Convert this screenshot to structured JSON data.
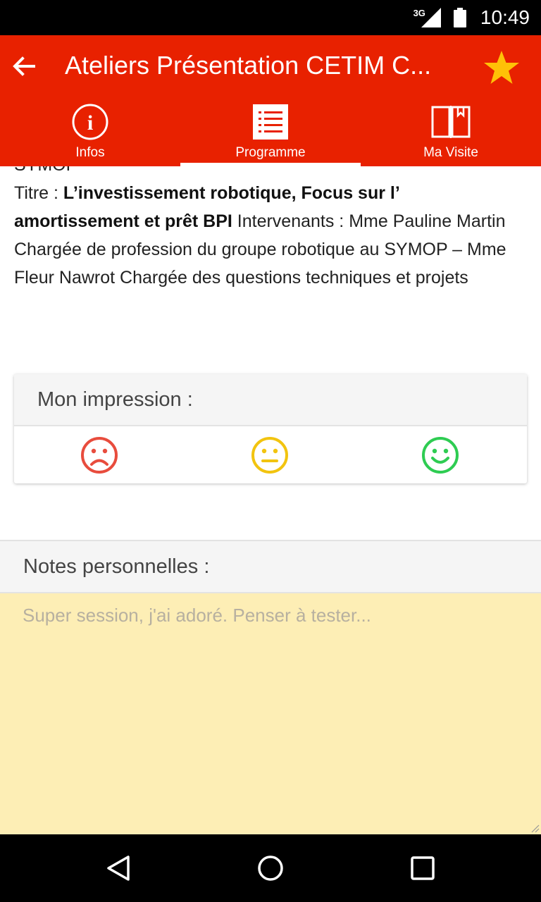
{
  "status_bar": {
    "network": "3G",
    "time": "10:49"
  },
  "app_bar": {
    "title": "Ateliers Présentation CETIM C...",
    "color": "#e82100"
  },
  "tabs": [
    {
      "label": "Infos",
      "icon": "info-icon",
      "active": false
    },
    {
      "label": "Programme",
      "icon": "list-icon",
      "active": true
    },
    {
      "label": "Ma Visite",
      "icon": "book-icon",
      "active": false
    }
  ],
  "content": {
    "cut_text": "SYMOP",
    "title_prefix": "Titre : ",
    "title_bold": "L’investissement robotique, Focus sur l’ amortissement et prêt BPI",
    "body": " Intervenants : Mme Pauline Martin Chargée de profession du groupe robotique au SYMOP – Mme Fleur Nawrot Chargée des questions techniques et projets"
  },
  "impression": {
    "label": "Mon impression :",
    "faces": [
      {
        "icon": "sad-face-icon",
        "color": "#e84c3d"
      },
      {
        "icon": "neutral-face-icon",
        "color": "#f2c40f"
      },
      {
        "icon": "happy-face-icon",
        "color": "#2ecc52"
      }
    ]
  },
  "notes": {
    "label": "Notes personnelles :",
    "placeholder": "Super session, j'ai adoré. Penser à tester...",
    "value": ""
  }
}
